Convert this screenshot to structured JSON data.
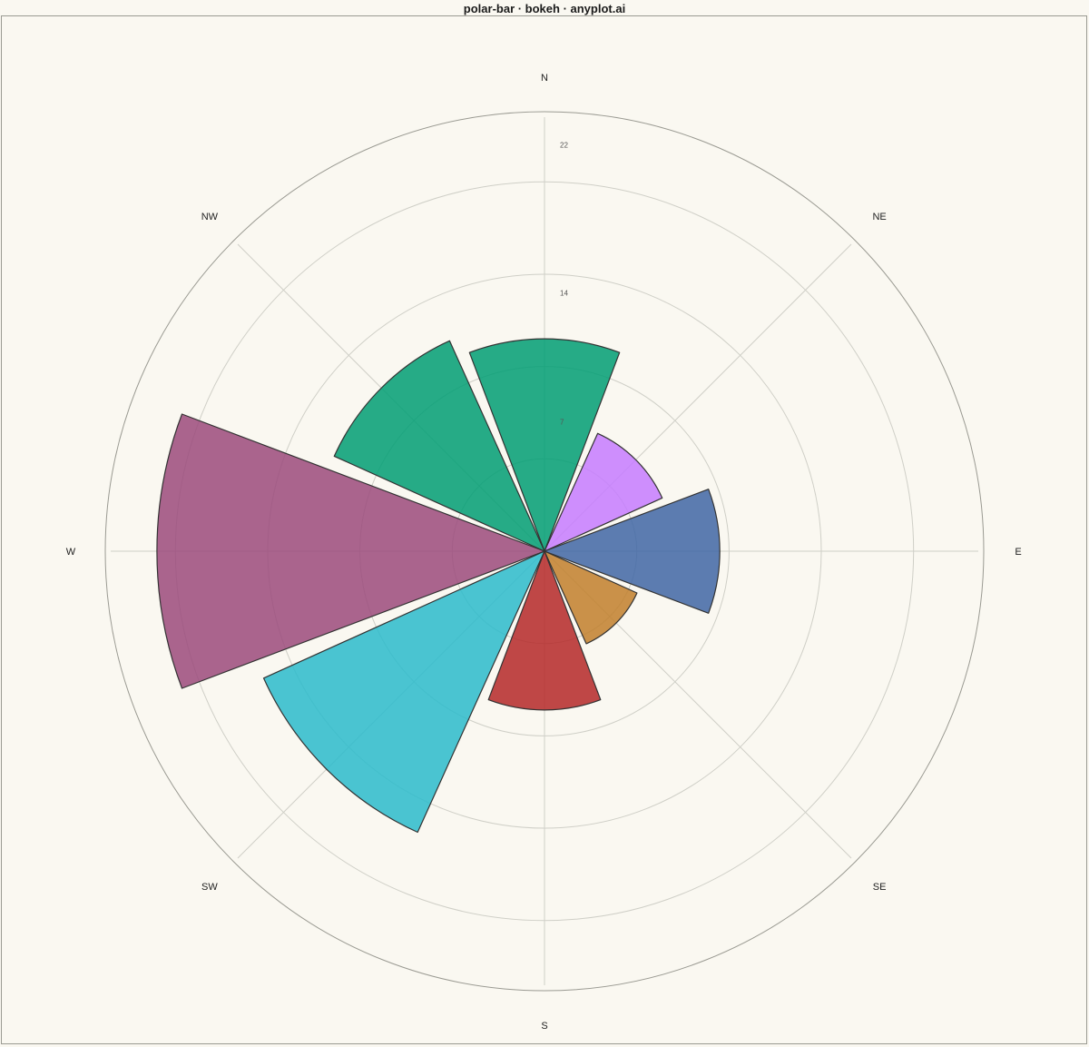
{
  "title": "polar-bar · bokeh · anyplot.ai",
  "chart_data": {
    "type": "bar",
    "subtype": "polar",
    "categories": [
      "N",
      "NE",
      "E",
      "SE",
      "S",
      "SW",
      "W",
      "NW"
    ],
    "values": [
      11.5,
      7.0,
      9.5,
      5.5,
      8.6,
      16.7,
      21.0,
      12.5
    ],
    "colors": [
      "#009E73",
      "#C57BFF",
      "#3F66A5",
      "#C17F2C",
      "#B42828",
      "#2ABBCB",
      "#9B4A7B",
      "#009E73"
    ],
    "radial_ticks": [
      {
        "value": 7,
        "label": "7"
      },
      {
        "value": 14,
        "label": "14"
      },
      {
        "value": 22,
        "label": "22"
      }
    ],
    "r_max": 23.8,
    "grid": true,
    "legend": "none"
  },
  "colors": {
    "background": "#FAF8F1",
    "grid": "#cfcfc7",
    "outline": "#333333"
  }
}
